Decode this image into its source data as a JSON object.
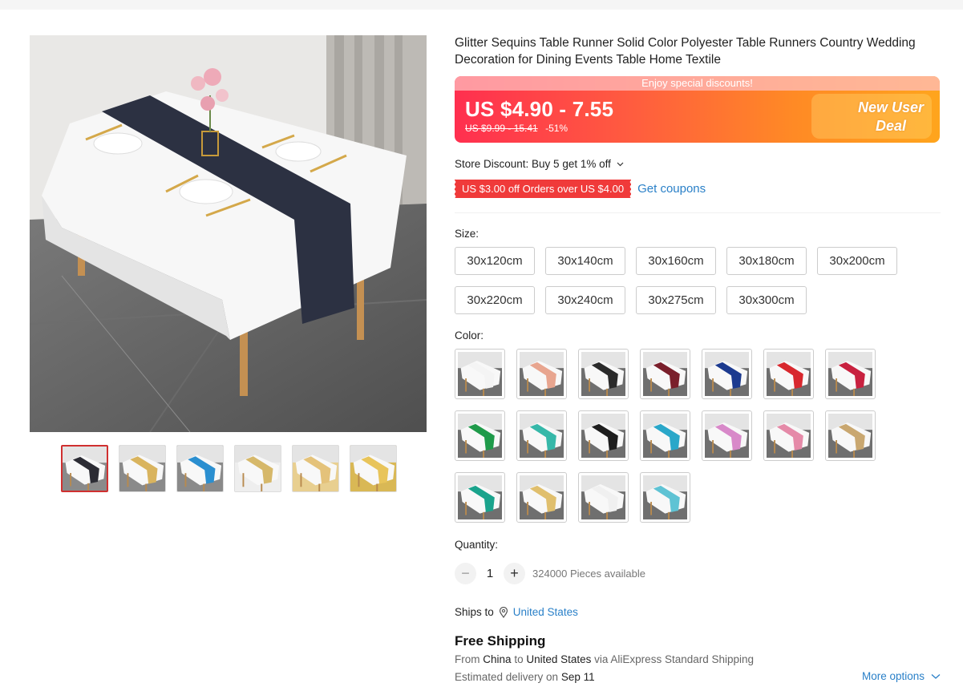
{
  "product": {
    "title": "Glitter Sequins Table Runner Solid Color Polyester Table Runners Country Wedding Decoration for Dining Events Table Home Textile"
  },
  "price": {
    "banner_text": "Enjoy special discounts!",
    "current": "US $4.90 - 7.55",
    "original": "US $9.99 - 15.41",
    "discount": "-51%",
    "deal_line1": "New User",
    "deal_line2": "Deal"
  },
  "store": {
    "discount_text": "Store Discount: Buy 5 get 1% off",
    "coupon_text": "US $3.00 off Orders over US $4.00",
    "get_coupons": "Get coupons"
  },
  "size": {
    "label": "Size:",
    "options": [
      "30x120cm",
      "30x140cm",
      "30x160cm",
      "30x180cm",
      "30x200cm",
      "30x220cm",
      "30x240cm",
      "30x275cm",
      "30x300cm"
    ]
  },
  "color": {
    "label": "Color:",
    "swatches": [
      "#f4f4f4",
      "#e8a58f",
      "#2b2b2b",
      "#7a1f2b",
      "#1c3a8f",
      "#d8282e",
      "#c8213f",
      "#1f9a4a",
      "#36b8a9",
      "#1e1e1e",
      "#2aa7c9",
      "#d889c9",
      "#e58aa8",
      "#c9a770",
      "#1aa38c",
      "#e0bf6d",
      "#f0f0f0",
      "#5fc3d4"
    ]
  },
  "quantity": {
    "label": "Quantity:",
    "minus": "−",
    "plus": "+",
    "value": "1",
    "available": "324000 Pieces available"
  },
  "shipping": {
    "ships_to_label": "Ships to",
    "country": "United States",
    "free_shipping": "Free Shipping",
    "from_prefix": "From",
    "from_country": "China",
    "to_word": "to",
    "to_country": "United States",
    "via_text": "via AliExpress Standard Shipping",
    "delivery_prefix": "Estimated delivery on",
    "delivery_date": "Sep 11",
    "more_options": "More options"
  },
  "gallery": {
    "thumbnails": [
      {
        "runner": "#2c2c34",
        "bg": "#8a8a8a"
      },
      {
        "runner": "#d9b45e",
        "bg": "#8a8a8a"
      },
      {
        "runner": "#2b8fd0",
        "bg": "#8a8a8a"
      },
      {
        "runner": "#d6b86a",
        "bg": "#eeeeee"
      },
      {
        "runner": "#e4c27a",
        "bg": "#e8cf90"
      },
      {
        "runner": "#e8c45a",
        "bg": "#d9b855"
      }
    ]
  },
  "colors_theme": {
    "accent_red": "#f03a3a",
    "link_blue": "#2a80c8"
  }
}
